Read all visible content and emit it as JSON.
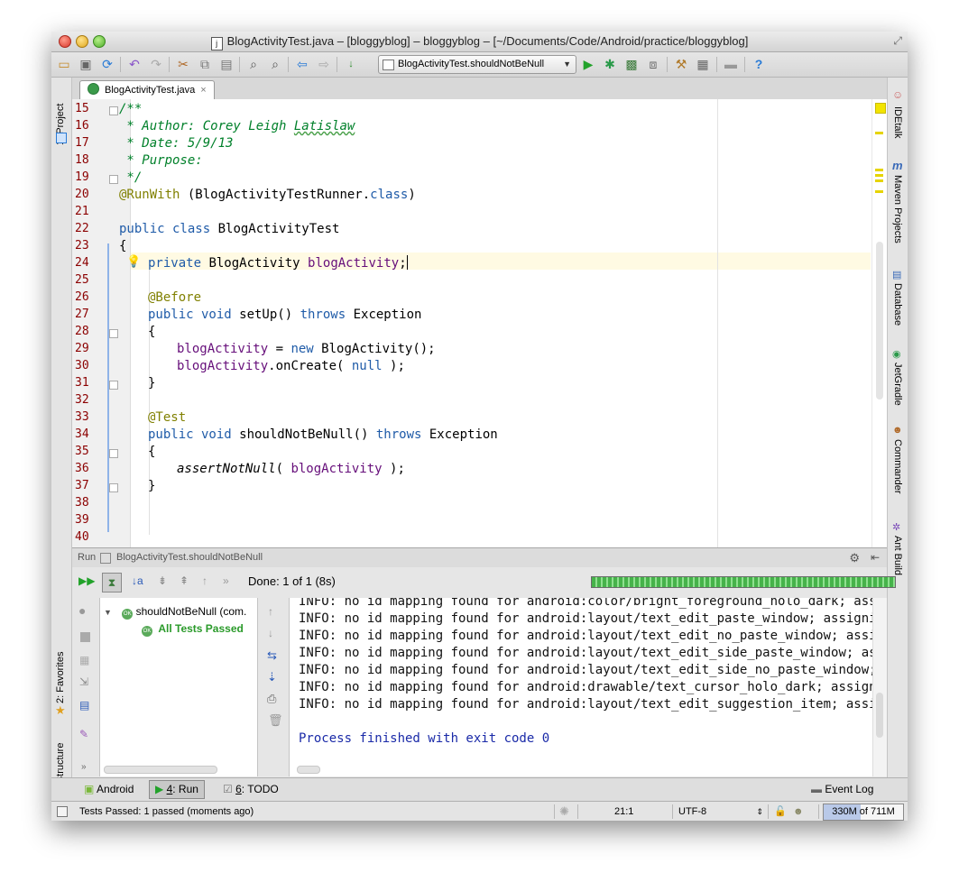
{
  "window": {
    "title": "BlogActivityTest.java – [bloggyblog] – bloggyblog – [~/Documents/Code/Android/practice/bloggyblog]",
    "title_file_icon": "j"
  },
  "toolbar": {
    "run_config": "BlogActivityTest.shouldNotBeNull",
    "icons": [
      "open-folder-icon",
      "save-icon",
      "sync-icon",
      "undo-icon",
      "redo-icon",
      "cut-icon",
      "copy-icon",
      "paste-icon",
      "find-icon",
      "replace-icon",
      "back-icon",
      "forward-icon",
      "build-icon",
      "run-icon",
      "debug-icon",
      "coverage-icon",
      "attach-icon",
      "settings-icon",
      "project-structure-icon",
      "sdk-icon",
      "help-icon"
    ]
  },
  "left_panels": {
    "project": "1: Project",
    "favorites": "2: Favorites",
    "structure": "Z: Structure"
  },
  "right_panels": {
    "idetalk": "IDEtalk",
    "maven": "Maven Projects",
    "database": "Database",
    "jetgradle": "JetGradle",
    "commander": "Commander",
    "ant": "Ant Build"
  },
  "editor": {
    "tab": "BlogActivityTest.java",
    "tab_close": "×",
    "line_numbers": [
      "15",
      "16",
      "17",
      "18",
      "19",
      "20",
      "21",
      "22",
      "23",
      "24",
      "25",
      "26",
      "27",
      "28",
      "29",
      "30",
      "31",
      "32",
      "33",
      "34",
      "35",
      "36",
      "37",
      "38",
      "39",
      "40"
    ],
    "lines": {
      "l15": "/**",
      "l16a": " * Author: Corey Leigh ",
      "l16b": "Latislaw",
      "l17": " * Date: 5/9/13",
      "l18": " * Purpose:",
      "l19": " */",
      "l20a": "@RunWith",
      "l20b": " (BlogActivityTestRunner.",
      "l20c": "class",
      "l20d": ")",
      "l22a": "public class",
      "l22b": " BlogActivityTest",
      "l23": "{",
      "l24a": "private",
      "l24b": " BlogActivity ",
      "l24c": "blogActivity",
      "l24d": ";",
      "l26": "@Before",
      "l27a": "public void",
      "l27b": " setUp() ",
      "l27c": "throws",
      "l27d": " Exception",
      "l28": "{",
      "l29a": "blogActivity",
      "l29b": " = ",
      "l29c": "new",
      "l29d": " BlogActivity();",
      "l30a": "blogActivity",
      "l30b": ".onCreate( ",
      "l30c": "null",
      "l30d": " );",
      "l31": "}",
      "l33": "@Test",
      "l34a": "public void",
      "l34b": " shouldNotBeNull() ",
      "l34c": "throws",
      "l34d": " Exception",
      "l35": "{",
      "l36a": "assertNotNull",
      "l36b": "( ",
      "l36c": "blogActivity",
      "l36d": " );",
      "l37": "}"
    }
  },
  "run": {
    "header_label": "Run",
    "header_config": "BlogActivityTest.shouldNotBeNull",
    "status": "Done: 1 of 1 (8s)",
    "progress": 1.0,
    "tree_item": "shouldNotBeNull (com.",
    "tree_result": "All Tests Passed",
    "ok_badge": "OK",
    "console_lines": [
      "INFO: no id mapping found for android:color/bright_foreground_holo_dark; assign",
      "INFO: no id mapping found for android:layout/text_edit_paste_window; assigning ",
      "INFO: no id mapping found for android:layout/text_edit_no_paste_window; assignin",
      "INFO: no id mapping found for android:layout/text_edit_side_paste_window; assign",
      "INFO: no id mapping found for android:layout/text_edit_side_no_paste_window; ass",
      "INFO: no id mapping found for android:drawable/text_cursor_holo_dark; assigning ",
      "INFO: no id mapping found for android:layout/text_edit_suggestion_item; assignin"
    ],
    "finish": "Process finished with exit code 0"
  },
  "bottom_tabs": {
    "android": "Android",
    "run_num": "4",
    "run_label": ": Run",
    "todo_num": "6",
    "todo_label": ": TODO",
    "event_log": "Event Log"
  },
  "statusbar": {
    "message": "Tests Passed: 1 passed (moments ago)",
    "position": "21:1",
    "encoding": "UTF-8",
    "memory": "330M of 711M",
    "memory_used_fraction": 0.464
  }
}
